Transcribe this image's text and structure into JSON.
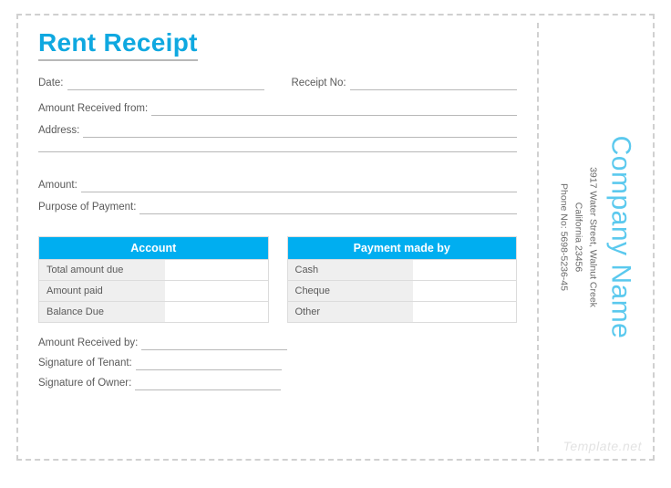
{
  "title": "Rent Receipt",
  "fields": {
    "date": "Date:",
    "receipt_no": "Receipt No:",
    "amount_received_from": "Amount Received from:",
    "address": "Address:",
    "amount": "Amount:",
    "purpose": "Purpose of Payment:",
    "amount_received_by": "Amount Received by:",
    "signature_tenant": "Signature of Tenant:",
    "signature_owner": "Signature of Owner:"
  },
  "account_table": {
    "header": "Account",
    "rows": [
      "Total amount due",
      "Amount paid",
      "Balance Due"
    ]
  },
  "payment_table": {
    "header": "Payment made by",
    "rows": [
      "Cash",
      "Cheque",
      "Other"
    ]
  },
  "company": {
    "name": "Company Name",
    "addr1": "3917 Water Street, Walnut Creek",
    "addr2": "California 23456",
    "phone": "Phone No: 5698-5236-45"
  },
  "watermark": "Template.net"
}
